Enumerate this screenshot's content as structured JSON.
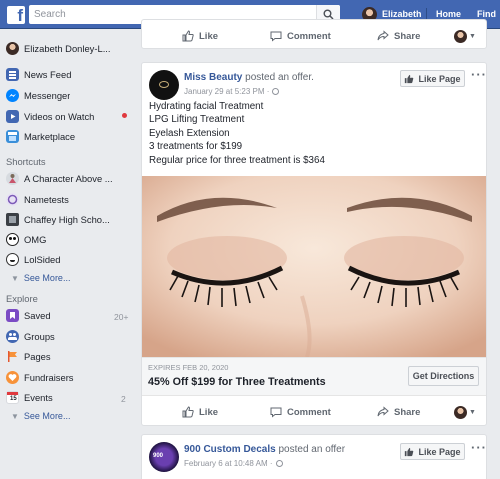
{
  "topbar": {
    "logo": "f",
    "search_placeholder": "Search",
    "user_name": "Elizabeth",
    "home_label": "Home",
    "find_label": "Find F"
  },
  "sidebar": {
    "profile_name": "Elizabeth Donley-L...",
    "main_items": [
      {
        "label": "News Feed",
        "icon": "news-feed-icon"
      },
      {
        "label": "Messenger",
        "icon": "messenger-icon"
      },
      {
        "label": "Videos on Watch",
        "icon": "watch-icon"
      },
      {
        "label": "Marketplace",
        "icon": "marketplace-icon"
      }
    ],
    "shortcuts_heading": "Shortcuts",
    "shortcuts": [
      {
        "label": "A Character Above ..."
      },
      {
        "label": "Nametests"
      },
      {
        "label": "Chaffey High Scho..."
      },
      {
        "label": "OMG"
      },
      {
        "label": "LolSided"
      }
    ],
    "see_more_1": "See More...",
    "explore_heading": "Explore",
    "explore": [
      {
        "label": "Saved",
        "count": "20+"
      },
      {
        "label": "Groups",
        "count": ""
      },
      {
        "label": "Pages",
        "count": ""
      },
      {
        "label": "Fundraisers",
        "count": ""
      },
      {
        "label": "Events",
        "count": "2"
      }
    ],
    "see_more_2": "See More..."
  },
  "actions": {
    "like": "Like",
    "comment": "Comment",
    "share": "Share"
  },
  "post1": {
    "page_name": "Miss Beauty",
    "verb": " posted an offer.",
    "date": "January 29 at 5:23 PM ·",
    "like_page": "Like Page",
    "lines": [
      "Hydrating facial Treatment",
      "LPG Lifting Treatment",
      "Eyelash Extension",
      "3 treatments for $199",
      "Regular price for three treatment is $364"
    ],
    "expires": "EXPIRES FEB 20, 2020",
    "offer_title": "45% Off $199 for Three Treatments",
    "cta": "Get Directions"
  },
  "post2": {
    "page_name": "900 Custom Decals",
    "verb": " posted an offer",
    "date": "February 6 at 10:48 AM ·",
    "like_page": "Like Page"
  },
  "colors": {
    "brand_blue": "#4267b2",
    "link_blue": "#365899",
    "background": "#e9ebee",
    "notification_red": "#e0393e"
  }
}
